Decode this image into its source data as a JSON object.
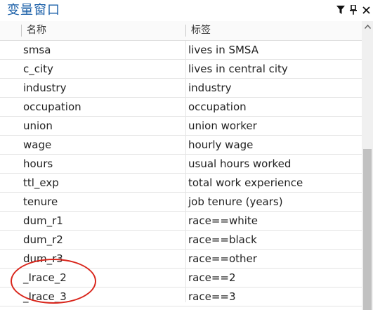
{
  "window": {
    "title": "变量窗口"
  },
  "toolbar": {
    "filter_icon": "filter-icon",
    "pin_icon": "pin-icon",
    "close_icon": "close-icon"
  },
  "table": {
    "headers": {
      "name": "名称",
      "label": "标签"
    },
    "rows": [
      {
        "name": "smsa",
        "label": "lives in SMSA"
      },
      {
        "name": "c_city",
        "label": "lives in central city"
      },
      {
        "name": "industry",
        "label": "industry"
      },
      {
        "name": "occupation",
        "label": "occupation"
      },
      {
        "name": "union",
        "label": "union worker"
      },
      {
        "name": "wage",
        "label": "hourly wage"
      },
      {
        "name": "hours",
        "label": "usual hours worked"
      },
      {
        "name": "ttl_exp",
        "label": "total work experience"
      },
      {
        "name": "tenure",
        "label": "job tenure (years)"
      },
      {
        "name": "dum_r1",
        "label": "race==white"
      },
      {
        "name": "dum_r2",
        "label": "race==black"
      },
      {
        "name": "dum_r3",
        "label": "race==other"
      },
      {
        "name": "_Irace_2",
        "label": "race==2"
      },
      {
        "name": "_Irace_3",
        "label": "race==3"
      }
    ]
  },
  "annotation": {
    "color": "#d9261c"
  },
  "colors": {
    "title": "#1a5fa8"
  }
}
